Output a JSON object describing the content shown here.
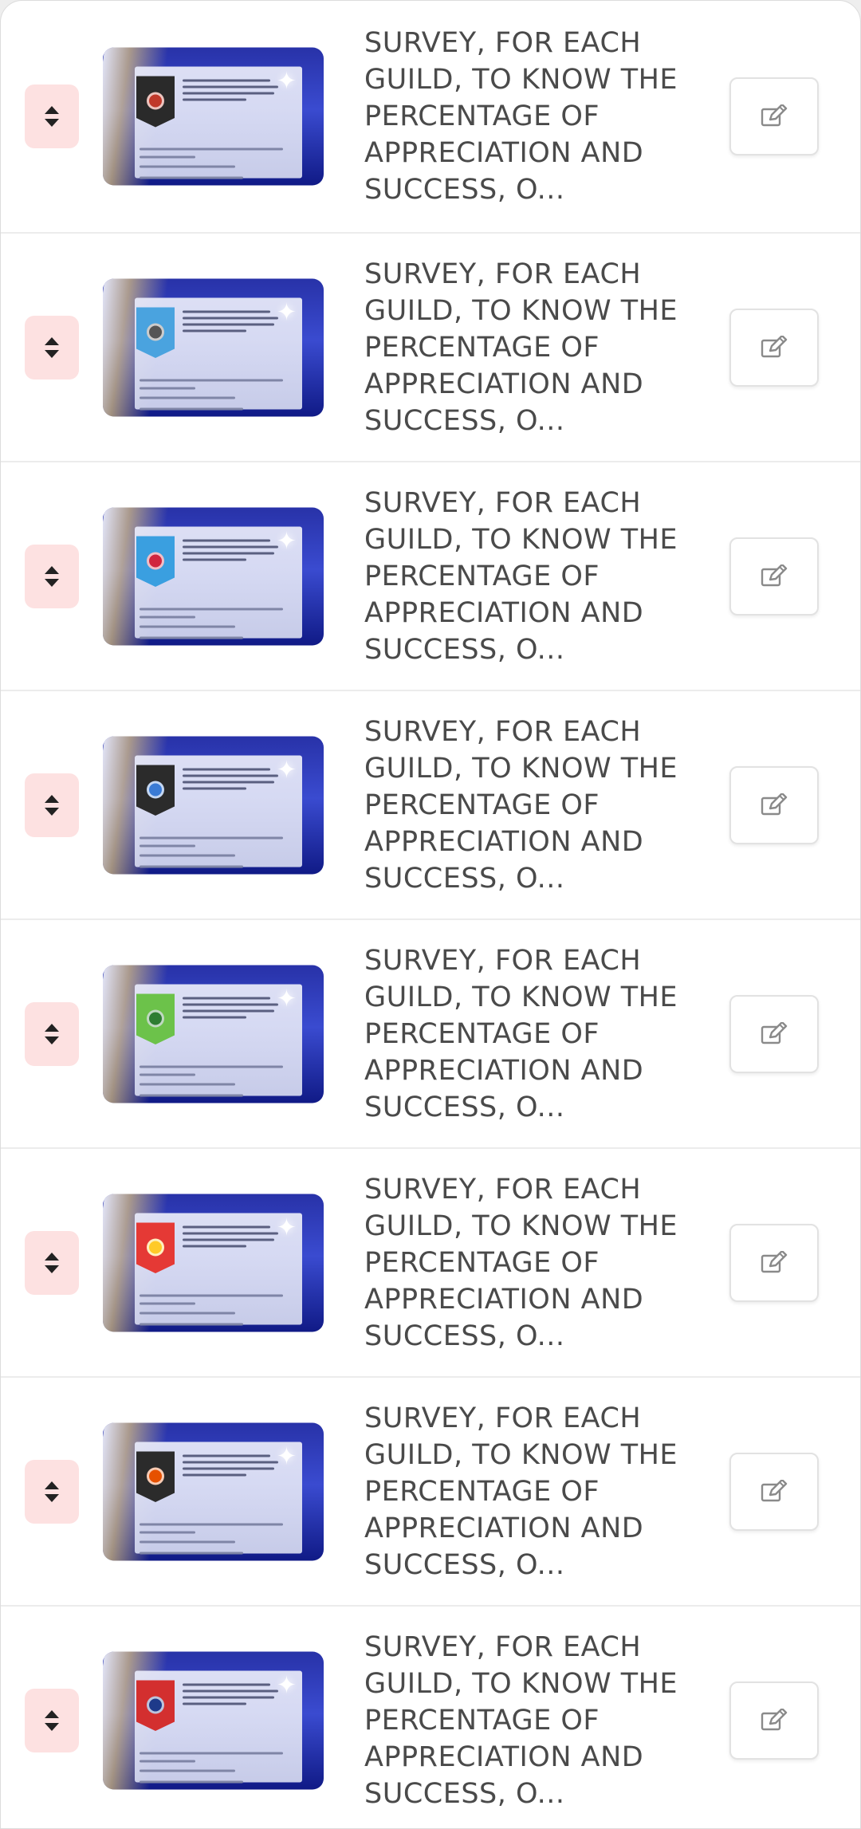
{
  "items": [
    {
      "title": "SURVEY, FOR EACH GUILD, TO KNOW THE PERCENTAGE OF APPRECIATION AND SUCCESS, O...",
      "banner_color": "#2a2a2a",
      "emblem_color": "#c0392b"
    },
    {
      "title": "SURVEY, FOR EACH GUILD, TO KNOW THE PERCENTAGE OF APPRECIATION AND SUCCESS, O...",
      "banner_color": "#4aa3df",
      "emblem_color": "#555555"
    },
    {
      "title": "SURVEY, FOR EACH GUILD, TO KNOW THE PERCENTAGE OF APPRECIATION AND SUCCESS, O...",
      "banner_color": "#3a9fe0",
      "emblem_color": "#d0263e"
    },
    {
      "title": "SURVEY, FOR EACH GUILD, TO KNOW THE PERCENTAGE OF APPRECIATION AND SUCCESS, O...",
      "banner_color": "#2b2b2b",
      "emblem_color": "#3a7bd5"
    },
    {
      "title": "SURVEY, FOR EACH GUILD, TO KNOW THE PERCENTAGE OF APPRECIATION AND SUCCESS, O...",
      "banner_color": "#6cc24a",
      "emblem_color": "#2e7d32"
    },
    {
      "title": "SURVEY, FOR EACH GUILD, TO KNOW THE PERCENTAGE OF APPRECIATION AND SUCCESS, O...",
      "banner_color": "#e53935",
      "emblem_color": "#ffca28"
    },
    {
      "title": "SURVEY, FOR EACH GUILD, TO KNOW THE PERCENTAGE OF APPRECIATION AND SUCCESS, O...",
      "banner_color": "#2b2b2b",
      "emblem_color": "#e65100"
    },
    {
      "title": "SURVEY, FOR EACH GUILD, TO KNOW THE PERCENTAGE OF APPRECIATION AND SUCCESS, O...",
      "banner_color": "#d32f2f",
      "emblem_color": "#1e3a8a"
    }
  ],
  "icons": {
    "drag": "sort-arrows-icon",
    "edit": "edit-pencil-icon"
  },
  "colors": {
    "drag_bg": "#fde1e1",
    "text": "#4a4a4a"
  }
}
